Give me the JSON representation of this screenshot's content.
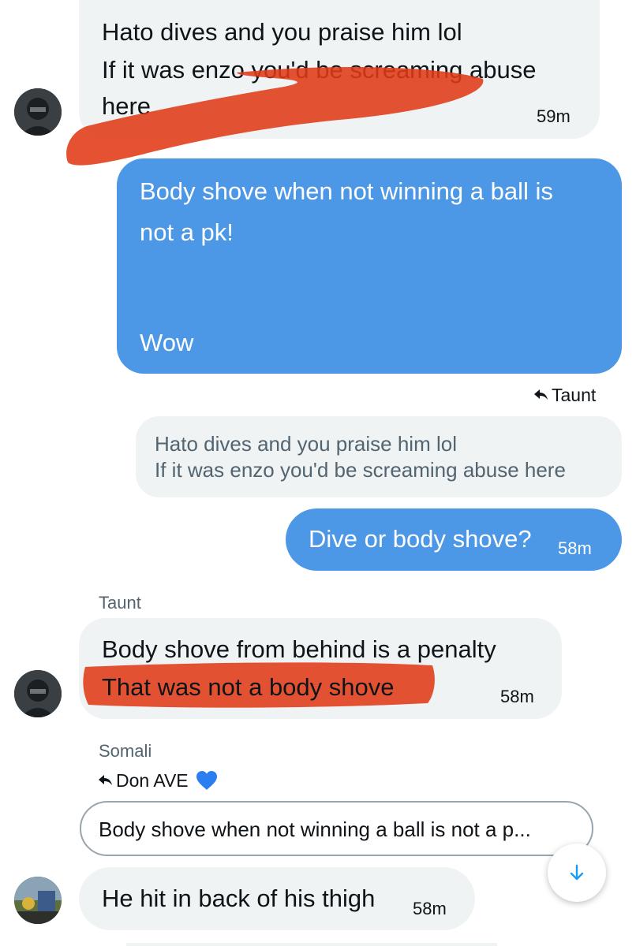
{
  "colors": {
    "outgoing_bubble": "#4c98e6",
    "incoming_bubble": "#eff3f4",
    "scribble": "#e03a16",
    "secondary_text": "#536471"
  },
  "messages": {
    "m1": {
      "lines": [
        "Hato dives and you praise him lol",
        "If it was enzo you'd be screaming abuse",
        "here"
      ],
      "time": "59m"
    },
    "m2": {
      "line1": "Body shove when not winning a ball is",
      "line2": "not a pk!",
      "line3": "Wow"
    },
    "m3": {
      "reply_to": "Taunt",
      "quoted": [
        "Hato dives and you praise him lol",
        "If it was enzo you'd be screaming abuse here"
      ],
      "text": "Dive or body shove?",
      "time": "58m"
    },
    "m4": {
      "sender": "Taunt",
      "lines": [
        "Body shove from behind is a penalty",
        "That was not a body shove"
      ],
      "time": "58m"
    },
    "m5": {
      "sender": "Somali",
      "reply_to": "Don AVE",
      "reply_emoji": "💙",
      "quoted": "Body shove when not winning a ball is not a p...",
      "text": "He hit in back of his thigh",
      "time": "58m"
    }
  },
  "icons": {
    "reply": "reply-arrow-icon",
    "scroll_down": "arrow-down-icon"
  }
}
